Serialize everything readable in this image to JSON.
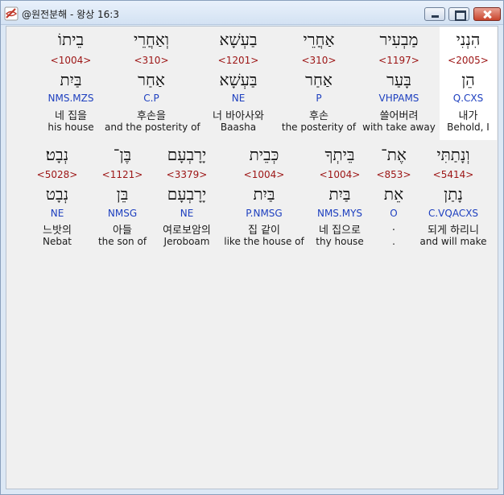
{
  "window": {
    "title": "@원전분해 - 왕상 16:3"
  },
  "rows": [
    {
      "words": [
        {
          "hebrew": "הִנְנִי",
          "strong": "<2005>",
          "root": "הֵן",
          "morph": "Q.CXS",
          "korean": "내가",
          "english": "Behold, I"
        },
        {
          "hebrew": "מַבְעִיר",
          "strong": "<1197>",
          "root": "בָּעַר",
          "morph": "VHPAMS",
          "korean": "쓸어버려",
          "english": "with take away"
        },
        {
          "hebrew": "אַחֲרֵי",
          "strong": "<310>",
          "root": "אַחַר",
          "morph": "P",
          "korean": "후손",
          "english": "the posterity of"
        },
        {
          "hebrew": "בַעְשָׁא",
          "strong": "<1201>",
          "root": "בַּעְשָׁא",
          "morph": "NE",
          "korean": "너 바아사와",
          "english": "Baasha"
        },
        {
          "hebrew": "וְאַחֲרֵי",
          "strong": "<310>",
          "root": "אַחַר",
          "morph": "C.P",
          "korean": "후손을",
          "english": "and the posterity of"
        },
        {
          "hebrew": "בֵיתוֹ",
          "strong": "<1004>",
          "root": "בַּיִת",
          "morph": "NMS.MZS",
          "korean": "네 집을",
          "english": "his house"
        }
      ]
    },
    {
      "words": [
        {
          "hebrew": "וְנָתַתִּי",
          "strong": "<5414>",
          "root": "נָתַן",
          "morph": "C.VQACXS",
          "korean": "되게 하리니",
          "english": "and will make"
        },
        {
          "hebrew": "אֶת־",
          "strong": "<853>",
          "root": "אֵת",
          "morph": "O",
          "korean": ".",
          "english": "."
        },
        {
          "hebrew": "בֵּיתְךָ",
          "strong": "<1004>",
          "root": "בַּיִת",
          "morph": "NMS.MYS",
          "korean": "네 집으로",
          "english": "thy house"
        },
        {
          "hebrew": "כְּבֵית",
          "strong": "<1004>",
          "root": "בַּיִת",
          "morph": "P.NMSG",
          "korean": "집 같이",
          "english": "like the house of"
        },
        {
          "hebrew": "יָרָבְעָם",
          "strong": "<3379>",
          "root": "יָרָבְעָם",
          "morph": "NE",
          "korean": "여로보암의",
          "english": "Jeroboam"
        },
        {
          "hebrew": "בֶּן־",
          "strong": "<1121>",
          "root": "בֵּן",
          "morph": "NMSG",
          "korean": "아들",
          "english": "the son of"
        },
        {
          "hebrew": "נְבָט׃",
          "strong": "<5028>",
          "root": "נְבָט",
          "morph": "NE",
          "korean": "느밧의",
          "english": "Nebat"
        }
      ]
    }
  ]
}
